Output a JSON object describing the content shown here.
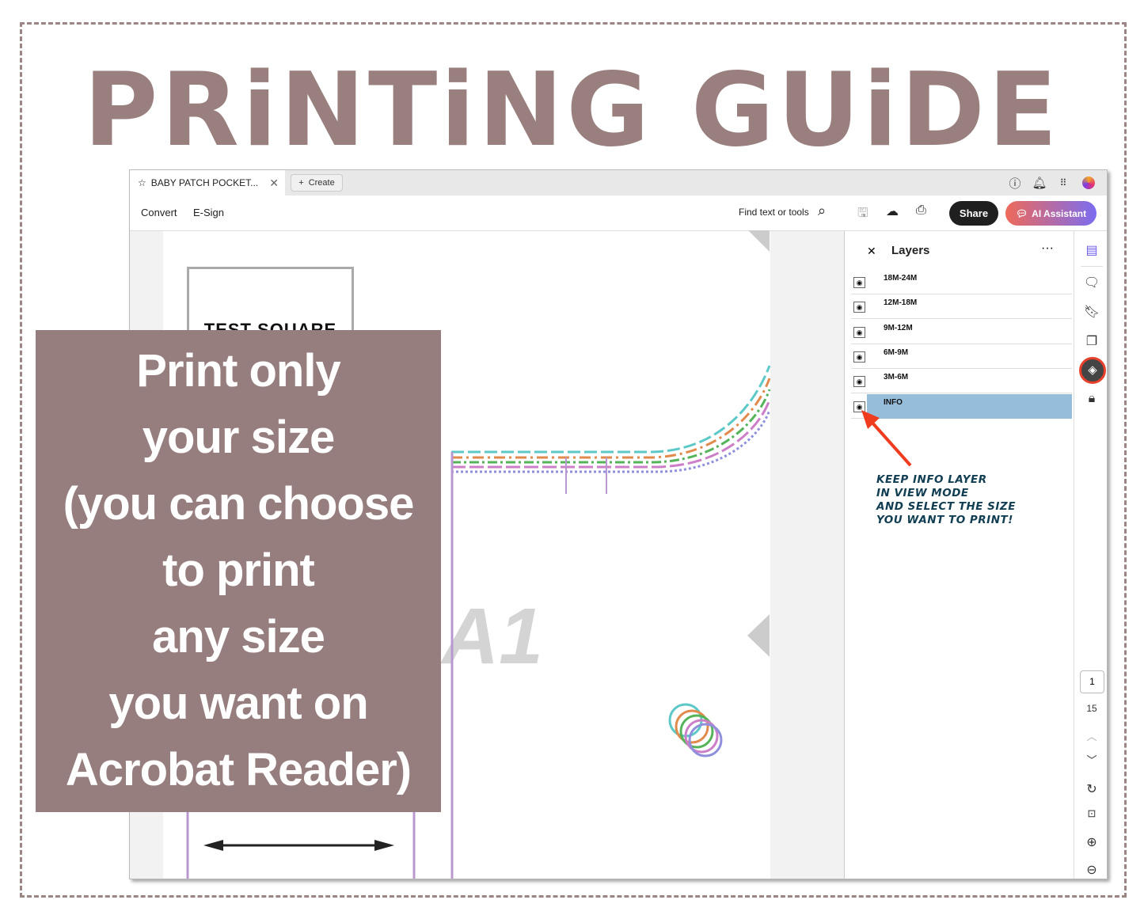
{
  "title": "PRiNTiNG GUiDE",
  "app": {
    "tab_title": "BABY PATCH POCKET...",
    "create_label": "Create",
    "menu": [
      "Convert",
      "E-Sign"
    ],
    "search_label": "Find text or tools",
    "share_label": "Share",
    "ai_label": "AI Assistant",
    "layers_title": "Layers",
    "layers": [
      {
        "label": "18M-24M",
        "visible": true
      },
      {
        "label": "12M-18M",
        "visible": true
      },
      {
        "label": "9M-12M",
        "visible": true
      },
      {
        "label": "6M-9M",
        "visible": true
      },
      {
        "label": "3M-6M",
        "visible": true
      },
      {
        "label": "INFO",
        "visible": true,
        "selected": true
      }
    ],
    "page_current": "1",
    "page_total": "15",
    "document": {
      "test_square": "TEST SQUARE",
      "piece_label": "A1"
    },
    "accent": "#e8402a"
  },
  "overlay": {
    "lines": [
      "Print only",
      "your size",
      "(you can choose",
      "to print",
      "any size",
      "you want on",
      "Acrobat Reader)"
    ]
  },
  "note": {
    "lines": [
      "KEEP INFO LAYER",
      "IN VIEW MODE",
      "AND SELECT THE SIZE",
      "YOU WANT TO PRINT!"
    ]
  },
  "colors": {
    "brand": "#977e7e",
    "note": "#113e52",
    "highlight": "#96bedb"
  }
}
